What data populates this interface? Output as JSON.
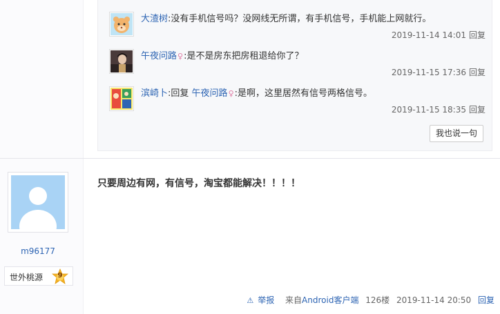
{
  "comments": [
    {
      "user": "大渣树",
      "user_gender": "",
      "text": ":没有手机信号吗？没网线无所谓，有手机信号，手机能上网就行。",
      "time": "2019-11-14 14:01",
      "reply_label": "回复",
      "avatar_icon": "cartoon-bear-avatar"
    },
    {
      "user": "午夜问路",
      "user_gender": "♀",
      "text": ":是不是房东把房租退给你了？",
      "time": "2019-11-15 17:36",
      "reply_label": "回复",
      "avatar_icon": "portrait-avatar"
    },
    {
      "user": "滨崎卜",
      "reply_prefix": ":回复",
      "reply_to": "午夜问路",
      "reply_to_gender": "♀",
      "text": ":是啊，这里居然有信号两格信号。",
      "time": "2019-11-15 18:35",
      "reply_label": "回复",
      "avatar_icon": "comic-avatar"
    }
  ],
  "say_button": "我也说一句",
  "post": {
    "author": "m96177",
    "level_name": "世外桃源",
    "level_number": "9",
    "content": "只要周边有网，有信号，淘宝都能解决！！！！",
    "report": "举报",
    "client_prefix": "来自",
    "client_name": "Android客户端",
    "floor": "126楼",
    "time": "2019-11-14 20:50",
    "reply_label": "回复"
  },
  "colors": {
    "link": "#2d64b3",
    "badge": "#f5b324"
  }
}
